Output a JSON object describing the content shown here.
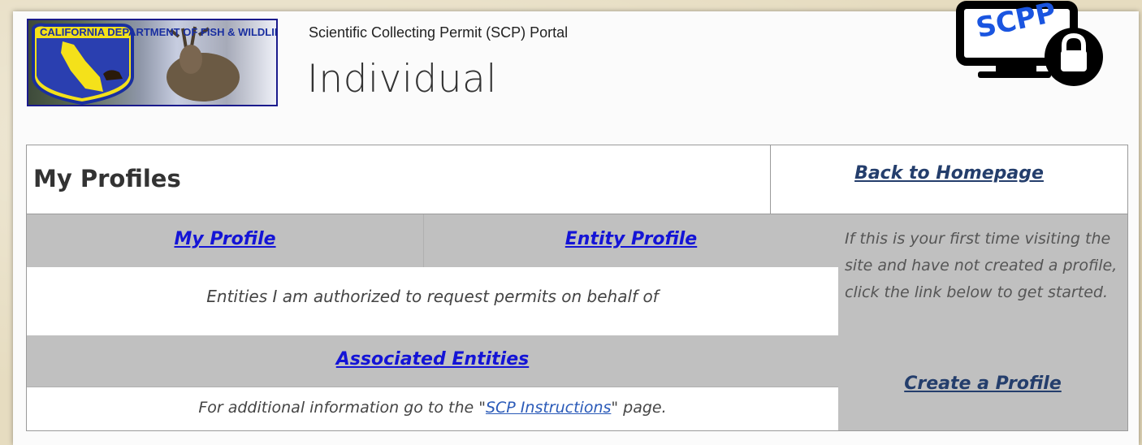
{
  "header": {
    "logo_text": "CALIFORNIA DEPARTMENT OF FISH & WILDLIFE",
    "subtitle": "Scientific Collecting Permit (SCP) Portal",
    "title": "Individual",
    "badge_text": "SCPP"
  },
  "profiles": {
    "heading": "My Profiles",
    "back_link": "Back to Homepage",
    "my_profile_link": "My Profile",
    "entity_profile_link": "Entity Profile",
    "entities_text": "Entities I am authorized to request permits on behalf of",
    "associated_entities_link": "Associated Entities",
    "info_prefix": "For additional information go to the \"",
    "info_link": "SCP Instructions",
    "info_suffix": "\" page."
  },
  "sidebar": {
    "first_time_text": "If this is your first time visiting the site and have not created a profile, click the link below to get started.",
    "create_profile_link": "Create a Profile"
  },
  "colors": {
    "link_blue": "#1414d6",
    "link_navy": "#243e6c",
    "grey_band": "#c0c0c0"
  }
}
